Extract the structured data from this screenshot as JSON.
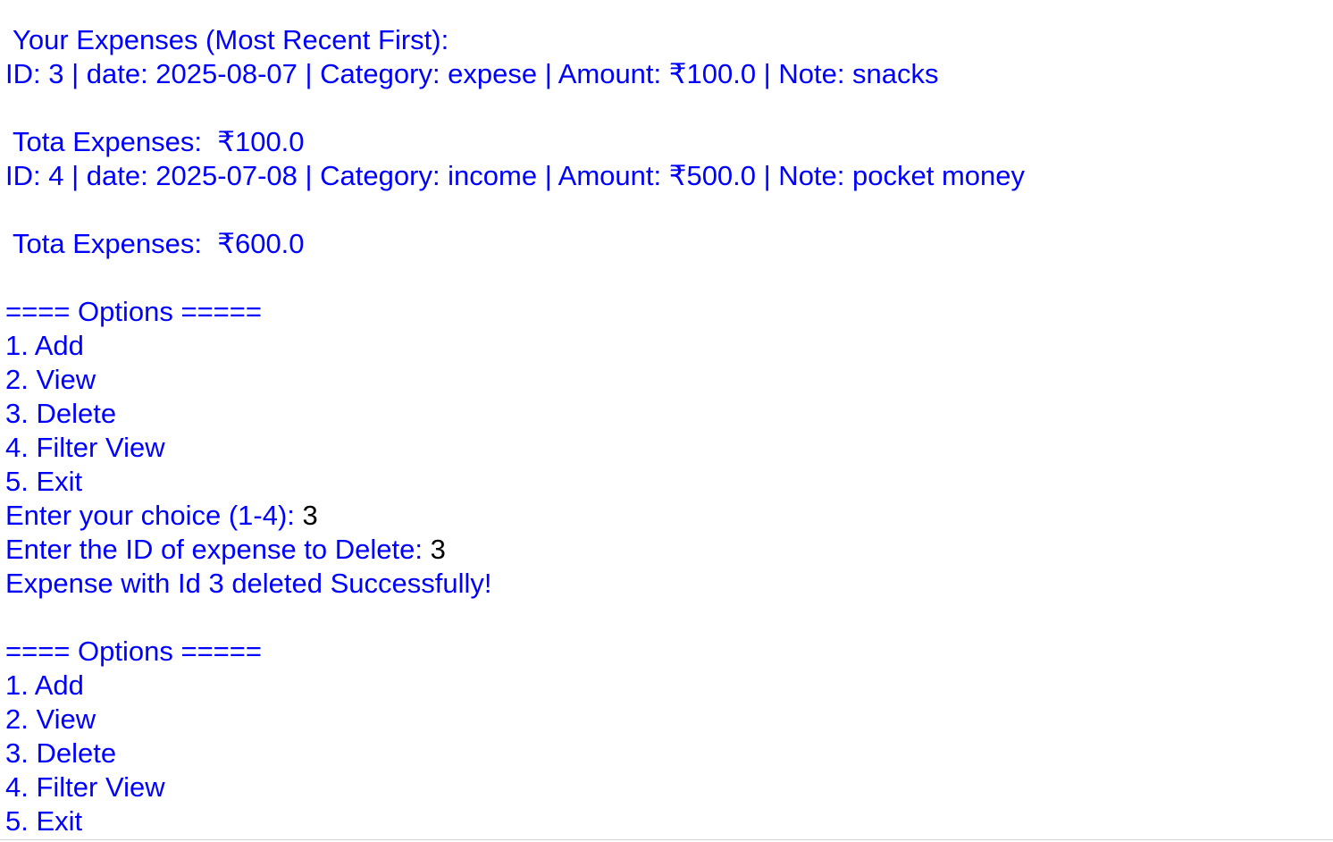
{
  "colors": {
    "output_text": "#0000ff",
    "input_text": "#000000",
    "background": "#ffffff"
  },
  "console": {
    "listing_header": " Your Expenses (Most Recent First):",
    "expense_1": "ID: 3 | date: 2025-08-07 | Category: expese | Amount: ₹100.0 | Note: snacks",
    "total_1": " Tota Expenses:  ₹100.0",
    "expense_2": "ID: 4 | date: 2025-07-08 | Category: income | Amount: ₹500.0 | Note: pocket money",
    "total_2": " Tota Expenses:  ₹600.0",
    "menu_1": {
      "header": "==== Options =====",
      "items": [
        "1. Add",
        "2. View",
        "3. Delete",
        "4. Filter View",
        "5. Exit"
      ]
    },
    "choice_prompt": "Enter your choice (1-4): ",
    "choice_value": "3",
    "delete_prompt": "Enter the ID of expense to Delete: ",
    "delete_value": "3",
    "delete_result": "Expense with Id 3 deleted Successfully!",
    "menu_2": {
      "header": "==== Options =====",
      "items": [
        "1. Add",
        "2. View",
        "3. Delete",
        "4. Filter View",
        "5. Exit"
      ]
    }
  }
}
